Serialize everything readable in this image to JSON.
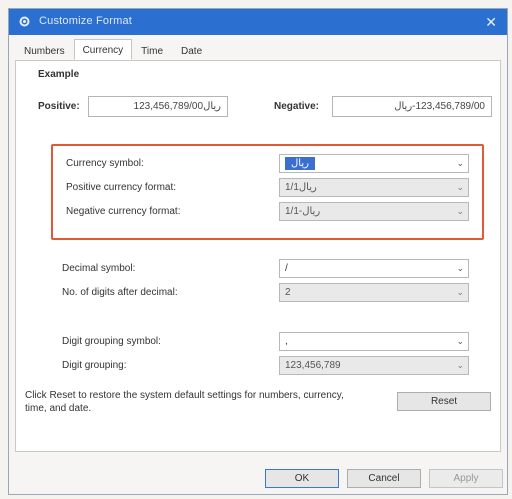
{
  "window": {
    "title": "Customize Format",
    "close_glyph": "✕"
  },
  "tabs": [
    "Numbers",
    "Currency",
    "Time",
    "Date"
  ],
  "active_tab": "Currency",
  "example": {
    "heading": "Example",
    "positive_label": "Positive:",
    "positive_value": "ریال123,456,789/00",
    "negative_label": "Negative:",
    "negative_value": "123,456,789/00-ریال"
  },
  "fields": {
    "currency_symbol": {
      "label": "Currency symbol:",
      "value": "ریال"
    },
    "positive_currency_format": {
      "label": "Positive currency format:",
      "value": "ریال1/1"
    },
    "negative_currency_format": {
      "label": "Negative currency format:",
      "value": "1/1-ریال"
    },
    "decimal_symbol": {
      "label": "Decimal symbol:",
      "value": "/"
    },
    "digits_after_decimal": {
      "label": "No. of digits after decimal:",
      "value": "2"
    },
    "digit_grouping_symbol": {
      "label": "Digit grouping symbol:",
      "value": ","
    },
    "digit_grouping": {
      "label": "Digit grouping:",
      "value": "123,456,789"
    }
  },
  "footer": {
    "reset_text": "Click Reset to restore the system default settings for numbers, currency, time, and date.",
    "reset_label": "Reset"
  },
  "buttons": {
    "ok": "OK",
    "cancel": "Cancel",
    "apply": "Apply"
  },
  "colors": {
    "titlebar": "#2b6fd1",
    "highlight_box": "#e05a36",
    "selection": "#3a6fd0"
  }
}
